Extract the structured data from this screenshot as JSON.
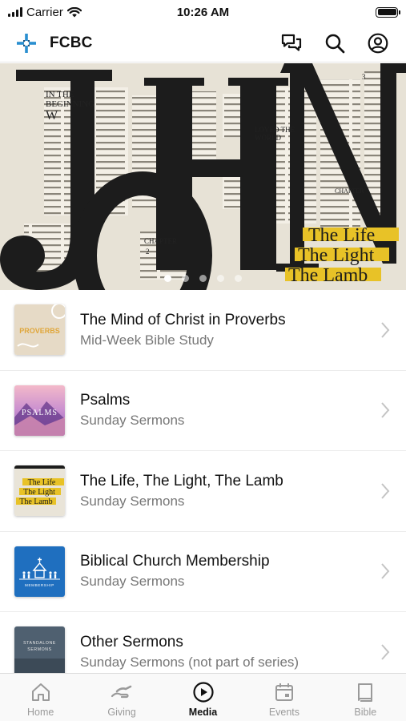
{
  "status_bar": {
    "carrier": "Carrier",
    "time": "10:26 AM",
    "battery_level": 1.0
  },
  "header": {
    "title": "FCBC",
    "logo_icon": "cross-logo-icon",
    "actions": [
      {
        "name": "chat-icon"
      },
      {
        "name": "search-icon"
      },
      {
        "name": "profile-icon"
      }
    ]
  },
  "hero": {
    "title_letters": [
      "J",
      "O",
      "H",
      "N"
    ],
    "tagline": [
      "The Life",
      "The Light",
      "The Lamb"
    ],
    "page_texts": [
      "IN THE",
      "BEGINNING",
      "W",
      "LOVED THE",
      "WORLD",
      "CHAPTER",
      "2",
      "CHAPTER",
      "3"
    ],
    "slide_count": 5,
    "active_slide": 1
  },
  "series": [
    {
      "title": "The Mind of Christ in Proverbs",
      "subtitle": "Mid-Week Bible Study",
      "thumb_label": "PROVERBS"
    },
    {
      "title": "Psalms",
      "subtitle": "Sunday Sermons",
      "thumb_label": "PSALMS"
    },
    {
      "title": "The Life, The Light, The Lamb",
      "subtitle": "Sunday Sermons",
      "thumb_label": [
        "The Life",
        "The Light",
        "The Lamb"
      ]
    },
    {
      "title": "Biblical Church Membership",
      "subtitle": "Sunday Sermons",
      "thumb_label": "MEMBERSHIP"
    },
    {
      "title": "Other Sermons",
      "subtitle": "Sunday Sermons (not part of series)",
      "thumb_label": [
        "STANDALONE",
        "SERMONS"
      ]
    }
  ],
  "tabs": [
    {
      "label": "Home",
      "icon": "home-icon",
      "active": false
    },
    {
      "label": "Giving",
      "icon": "giving-icon",
      "active": false
    },
    {
      "label": "Media",
      "icon": "play-icon",
      "active": true
    },
    {
      "label": "Events",
      "icon": "calendar-icon",
      "active": false
    },
    {
      "label": "Bible",
      "icon": "book-icon",
      "active": false
    }
  ],
  "colors": {
    "accent_yellow": "#e8c227",
    "logo_blue": "#2a8fd0",
    "active_tab": "#111111",
    "inactive_tab": "#9a9a9a"
  }
}
